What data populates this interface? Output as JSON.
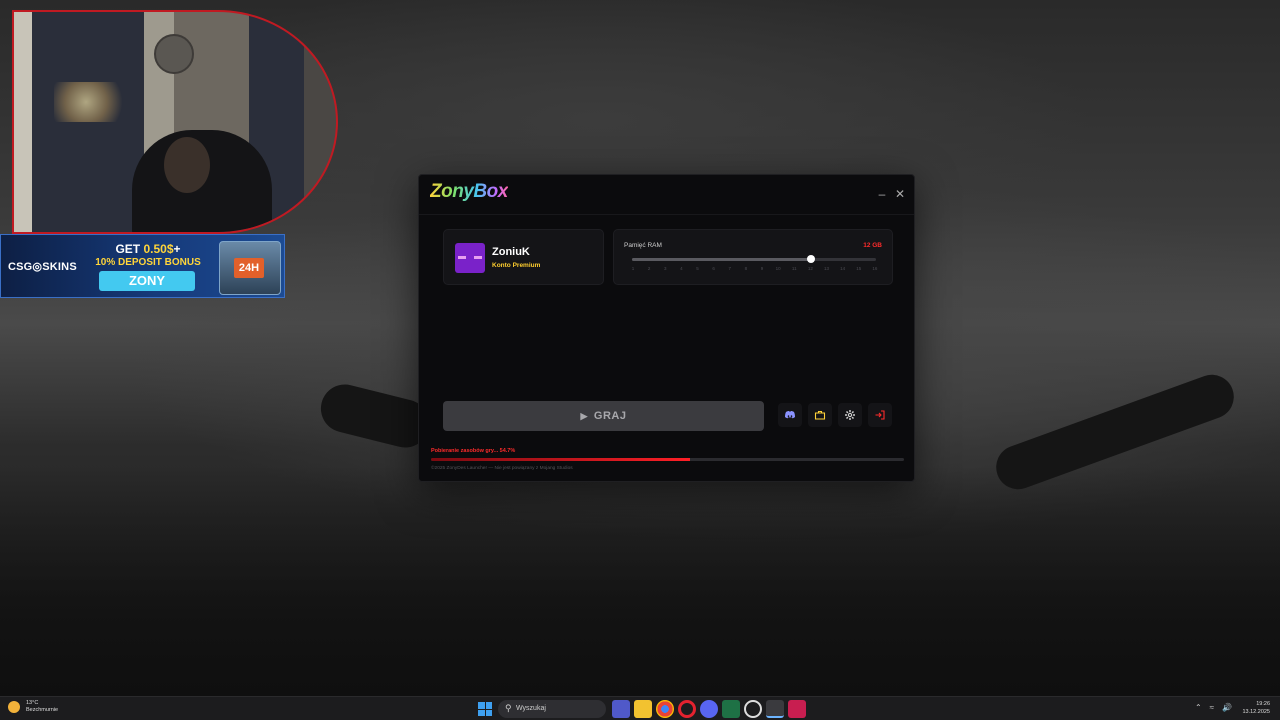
{
  "ad": {
    "brand": "CSG◎SKINS",
    "get_prefix": "GET ",
    "get_amount": "0.50$",
    "get_suffix": "+",
    "bonus": "10% DEPOSIT BONUS",
    "code": "ZONY",
    "case_label": "24H"
  },
  "launcher": {
    "logo": "ZonyBox",
    "minimize": "–",
    "close": "✕",
    "user": {
      "name": "ZoniuK",
      "account_type": "Konto Premium"
    },
    "ram": {
      "label": "Pamięć RAM",
      "value": "12 GB",
      "current": 12,
      "max": 16,
      "ticks": [
        "1",
        "2",
        "3",
        "4",
        "5",
        "6",
        "7",
        "8",
        "9",
        "10",
        "11",
        "12",
        "13",
        "14",
        "15",
        "16"
      ]
    },
    "play_label": "GRAJ",
    "play_icon": "▶",
    "tools": [
      {
        "name": "discord-icon",
        "color": "#8b93ff"
      },
      {
        "name": "briefcase-icon",
        "color": "#ffd23a"
      },
      {
        "name": "gear-icon",
        "color": "#d0d0d0"
      },
      {
        "name": "logout-icon",
        "color": "#ff2b2b"
      }
    ],
    "status": "Pobieranie zasobów gry... 54.7%",
    "progress": 0.547,
    "footer": "©2025 ZonyDes Launcher — Nie jest powiązany z Mojang Studios"
  },
  "taskbar": {
    "temperature": "13°C",
    "weather": "Bezchmurnie",
    "search_placeholder": "Wyszukaj",
    "time": "19:26",
    "date": "13.12.2025"
  }
}
